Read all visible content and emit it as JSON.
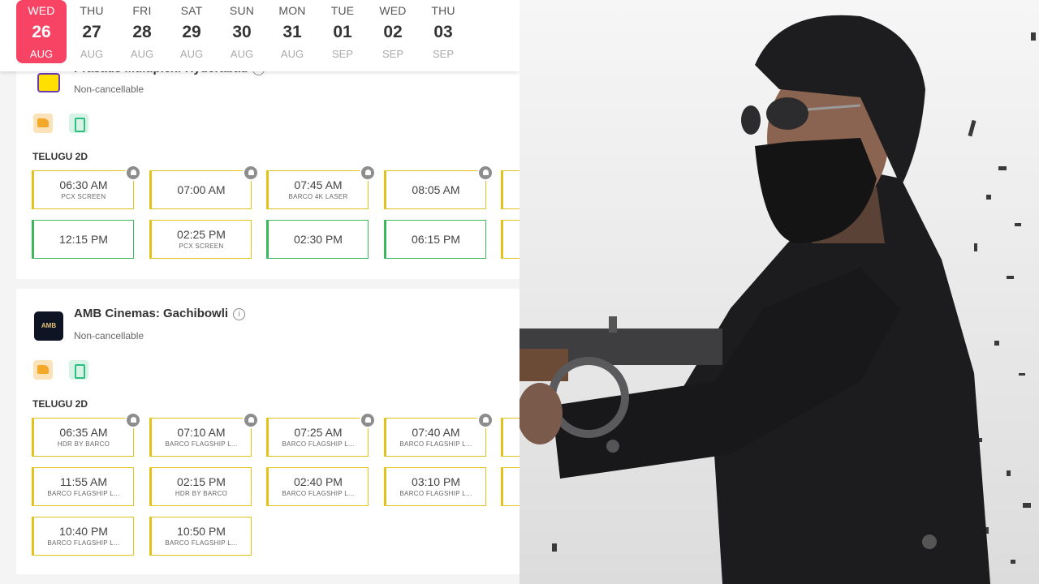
{
  "dates": [
    {
      "dow": "WED",
      "day": "26",
      "month": "AUG",
      "active": true
    },
    {
      "dow": "THU",
      "day": "27",
      "month": "AUG"
    },
    {
      "dow": "FRI",
      "day": "28",
      "month": "AUG"
    },
    {
      "dow": "SAT",
      "day": "29",
      "month": "AUG"
    },
    {
      "dow": "SUN",
      "day": "30",
      "month": "AUG"
    },
    {
      "dow": "MON",
      "day": "31",
      "month": "AUG"
    },
    {
      "dow": "TUE",
      "day": "01",
      "month": "SEP"
    },
    {
      "dow": "WED",
      "day": "02",
      "month": "SEP"
    },
    {
      "dow": "THU",
      "day": "03",
      "month": "SEP"
    }
  ],
  "cinemas": [
    {
      "name": "Prasads Multiplex: Hyderabad",
      "policy": "Non-cancellable",
      "language": "TELUGU 2D",
      "showtimes": [
        {
          "time": "06:30 AM",
          "screen": "PCX SCREEN"
        },
        {
          "time": "07:00 AM",
          "screen": ""
        },
        {
          "time": "07:45 AM",
          "screen": "BARCO 4K LASER"
        },
        {
          "time": "08:05 AM",
          "screen": ""
        },
        {
          "time": "12:15 PM",
          "screen": ""
        },
        {
          "time": "02:25 PM",
          "screen": "PCX SCREEN"
        },
        {
          "time": "02:30 PM",
          "screen": ""
        },
        {
          "time": "06:15 PM",
          "screen": ""
        }
      ]
    },
    {
      "name": "AMB Cinemas: Gachibowli",
      "logo_text": "AMB",
      "policy": "Non-cancellable",
      "language": "TELUGU 2D",
      "showtimes": [
        {
          "time": "06:35 AM",
          "screen": "HDR BY BARCO"
        },
        {
          "time": "07:10 AM",
          "screen": "BARCO FLAGSHIP L..."
        },
        {
          "time": "07:25 AM",
          "screen": "BARCO FLAGSHIP L..."
        },
        {
          "time": "07:40 AM",
          "screen": "BARCO FLAGSHIP L..."
        },
        {
          "time": "11:55 AM",
          "screen": "BARCO FLAGSHIP L..."
        },
        {
          "time": "02:15 PM",
          "screen": "HDR BY BARCO"
        },
        {
          "time": "02:40 PM",
          "screen": "BARCO FLAGSHIP L..."
        },
        {
          "time": "03:10 PM",
          "screen": "BARCO FLAGSHIP L..."
        },
        {
          "time": "10:40 PM",
          "screen": "BARCO FLAGSHIP L..."
        },
        {
          "time": "10:50 PM",
          "screen": "BARCO FLAGSHIP L..."
        }
      ]
    }
  ],
  "colors": {
    "accent": "#f84464",
    "available": "#e3c21b",
    "fast_filling": "#3bb85a"
  },
  "icons": [
    "info-icon",
    "food-icon",
    "mticket-icon",
    "bell-icon"
  ]
}
